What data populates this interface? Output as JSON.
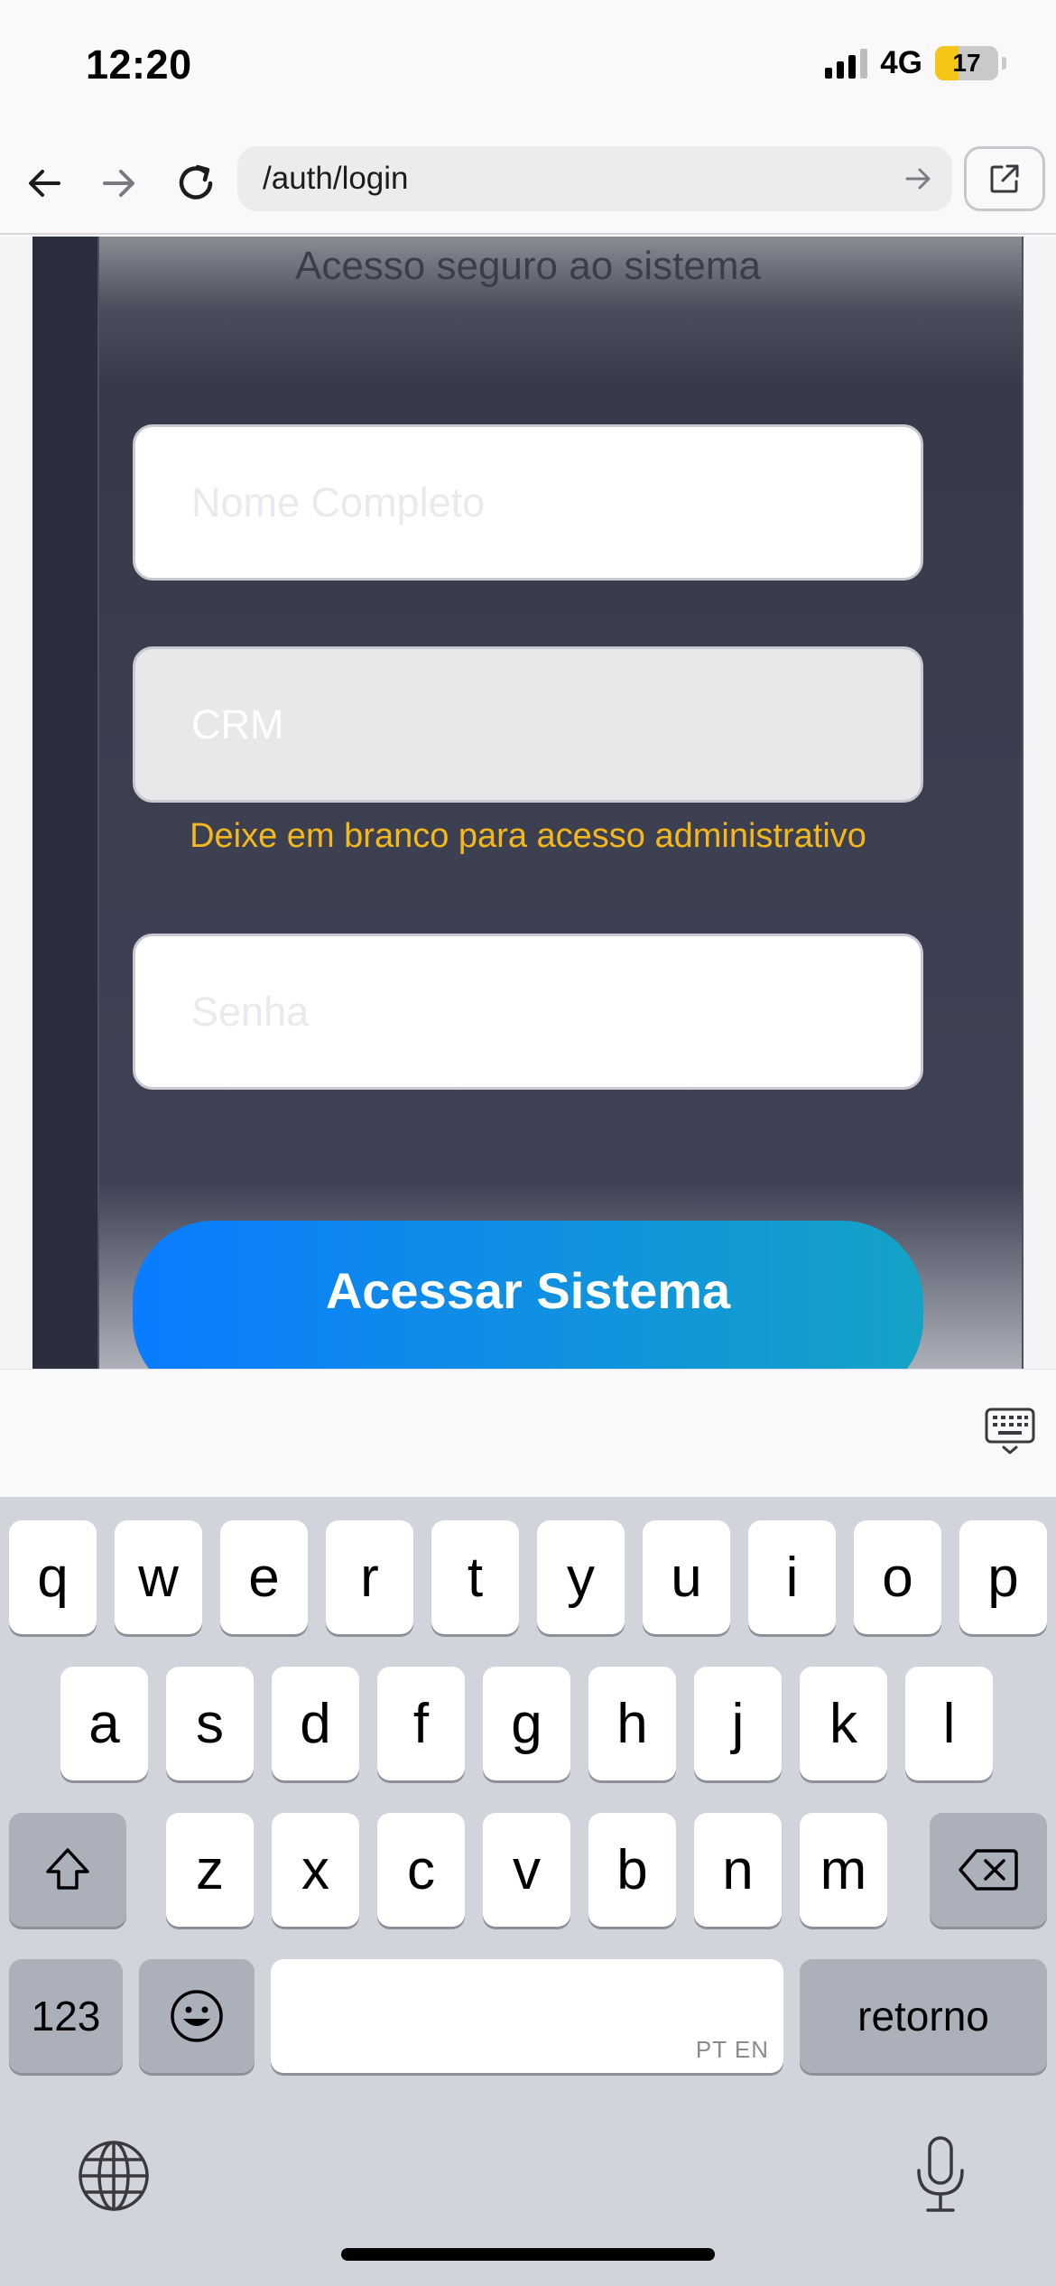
{
  "status_bar": {
    "time": "12:20",
    "network": "4G",
    "battery_level": "17",
    "battery_fraction": 0.17,
    "battery_color": "#f5c518"
  },
  "browser": {
    "url": "/auth/login",
    "back_icon": "arrow-left-icon",
    "forward_icon": "arrow-right-icon",
    "reload_icon": "reload-icon",
    "go_icon": "arrow-right-icon",
    "open_external_icon": "external-link-icon"
  },
  "login_form": {
    "subtitle": "Acesso seguro ao sistema",
    "name_placeholder": "Nome Completo",
    "crm_placeholder": "CRM",
    "crm_hint": "Deixe em branco para acesso administrativo",
    "password_placeholder": "Senha",
    "submit_label": "Acessar Sistema",
    "hint_color": "#f5b81c",
    "button_gradient": [
      "#0a7cff",
      "#14a3c6"
    ]
  },
  "keyboard": {
    "dismiss_icon": "keyboard-dismiss-icon",
    "row1": [
      "q",
      "w",
      "e",
      "r",
      "t",
      "y",
      "u",
      "i",
      "o",
      "p"
    ],
    "row2": [
      "a",
      "s",
      "d",
      "f",
      "g",
      "h",
      "j",
      "k",
      "l"
    ],
    "row3": [
      "z",
      "x",
      "c",
      "v",
      "b",
      "n",
      "m"
    ],
    "shift_icon": "shift-icon",
    "delete_icon": "delete-icon",
    "numbers_label": "123",
    "emoji_icon": "emoji-icon",
    "space_languages": "PT EN",
    "return_label": "retorno",
    "globe_icon": "globe-icon",
    "mic_icon": "microphone-icon"
  }
}
